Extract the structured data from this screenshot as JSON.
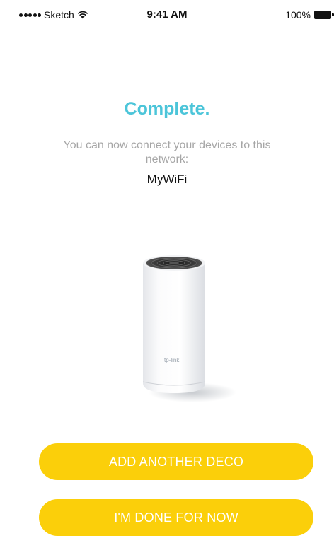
{
  "status_bar": {
    "carrier": "Sketch",
    "time": "9:41 AM",
    "battery": "100%"
  },
  "content": {
    "title": "Complete.",
    "message": "You can now connect your devices to this network:",
    "network_name": "MyWiFi",
    "device_brand": "tp-link"
  },
  "buttons": {
    "add_another": "ADD ANOTHER DECO",
    "done": "I'M DONE FOR NOW"
  },
  "colors": {
    "accent": "#4cc5d9",
    "button": "#fbcf0a",
    "button_text": "#ffffff",
    "muted_text": "#a6a6a6"
  }
}
